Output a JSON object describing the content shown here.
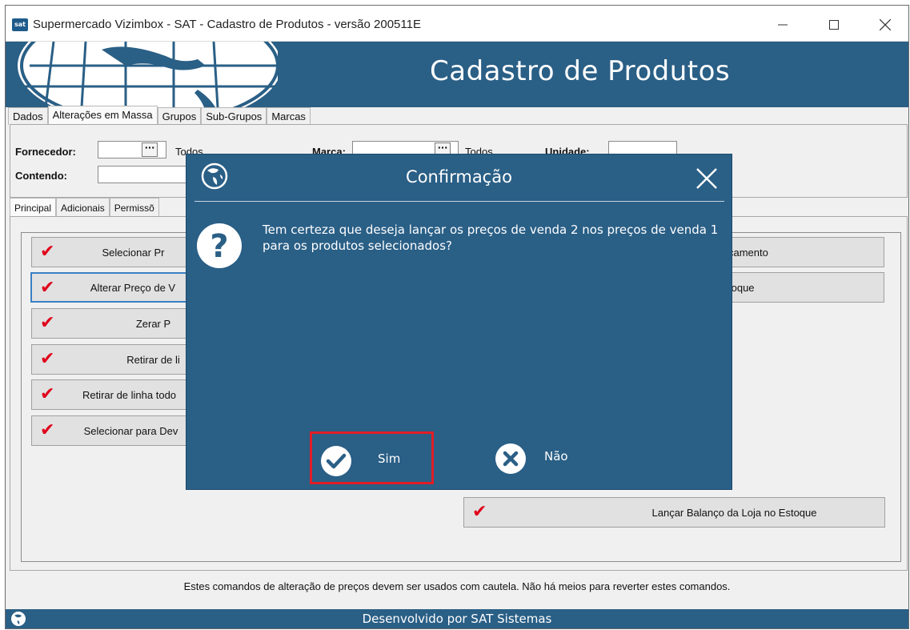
{
  "window": {
    "title": "Supermercado Vizimbox - SAT - Cadastro de Produtos - versão 200511E",
    "app_icon_text": "sat"
  },
  "banner": {
    "title": "Cadastro de Produtos"
  },
  "main_tabs": [
    "Dados",
    "Alterações em Massa",
    "Grupos",
    "Sub-Grupos",
    "Marcas"
  ],
  "filters": {
    "fornecedor_label": "Fornecedor:",
    "fornecedor_all": "Todos",
    "marca_label": "Marca:",
    "marca_all": "Todos",
    "unidade_label": "Unidade:",
    "contendo_label": "Contendo:",
    "lookup_button": "···"
  },
  "sub_tabs": [
    "Principal",
    "Adicionais",
    "Permissõ"
  ],
  "actions_left": [
    "Selecionar Pr",
    "Alterar Preço de V",
    "Zerar P",
    "Retirar de li",
    "Retirar de linha todo",
    "Selecionar para Dev"
  ],
  "actions_right": [
    "çamento",
    "toque"
  ],
  "action_bottom": "Lançar Balanço da Loja no Estoque",
  "footer_note": "Estes comandos de alteração de preços devem ser usados com cautela. Não há meios para reverter estes comandos.",
  "status_bar": "Desenvolvido por SAT Sistemas",
  "dialog": {
    "title": "Confirmação",
    "message": "Tem certeza que deseja lançar os preços de venda 2 nos preços de venda 1 para os produtos selecionados?",
    "yes_label": "Sim",
    "no_label": "Não"
  },
  "colors": {
    "brand_blue": "#2a5f86",
    "check_red": "#e0001b",
    "highlight_red": "#e11d28"
  }
}
